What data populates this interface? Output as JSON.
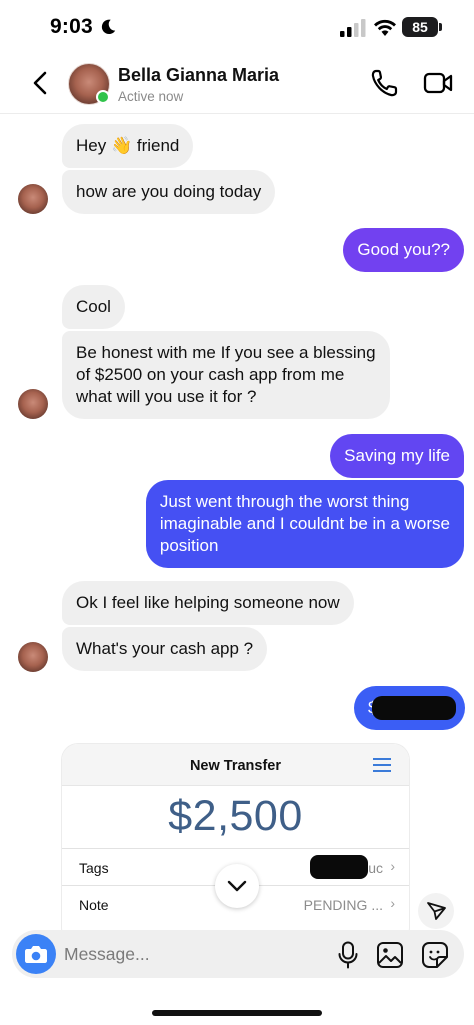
{
  "status_bar": {
    "time": "9:03",
    "battery": "85"
  },
  "header": {
    "contact_name": "Bella Gianna Maria",
    "contact_status": "Active now"
  },
  "messages": [
    {
      "dir": "in",
      "text": "Hey 👋 friend"
    },
    {
      "dir": "in",
      "text": "how are you doing today"
    },
    {
      "dir": "out",
      "text": "Good you??"
    },
    {
      "dir": "in",
      "text": "Cool"
    },
    {
      "dir": "in",
      "text": "Be honest with me If you see a blessing\nof $2500 on your cash app from me\nwhat will you use it for ?"
    },
    {
      "dir": "out",
      "text": "Saving my life"
    },
    {
      "dir": "out",
      "text": "Just went through the worst thing\nimaginable and I couldnt be in a worse\nposition"
    },
    {
      "dir": "in",
      "text": "Ok I feel like helping someone now"
    },
    {
      "dir": "in",
      "text": "What's your cash app ?"
    },
    {
      "dir": "out",
      "text": "$"
    }
  ],
  "transfer": {
    "title": "New Transfer",
    "amount": "$2,500",
    "rows": [
      {
        "label": "Tags",
        "value": "uc"
      },
      {
        "label": "Note",
        "value": "PENDING ..."
      }
    ]
  },
  "composer": {
    "placeholder": "Message..."
  },
  "colors": {
    "outgoing_bubble_start": "#7b3ff0",
    "outgoing_bubble_end": "#3b5ef5",
    "incoming_bubble": "#efefef",
    "online": "#31c34b",
    "camera": "#3b82f6",
    "amount": "#3f5f88"
  },
  "icons": [
    "moon-icon",
    "signal-icon",
    "wifi-icon",
    "back-icon",
    "phone-icon",
    "video-icon",
    "menu-icon",
    "chevron-down-icon",
    "send-icon",
    "camera-icon",
    "mic-icon",
    "gallery-icon",
    "sticker-icon"
  ]
}
